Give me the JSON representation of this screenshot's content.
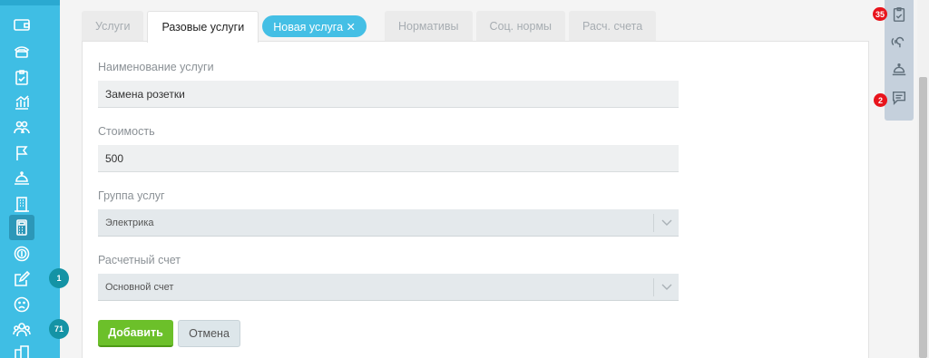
{
  "sidebar": {
    "items": [
      {
        "icon": "wallet-icon"
      },
      {
        "icon": "handset-icon"
      },
      {
        "icon": "clipboard-check-icon"
      },
      {
        "icon": "chart-icon"
      },
      {
        "icon": "people-icon"
      },
      {
        "icon": "flag-icon"
      },
      {
        "icon": "service-bell-icon"
      },
      {
        "icon": "building-icon"
      },
      {
        "icon": "calculator-icon",
        "active": true
      },
      {
        "icon": "coin-icon"
      },
      {
        "icon": "edit-icon",
        "badge": "1"
      },
      {
        "icon": "sad-face-icon"
      },
      {
        "icon": "group-icon",
        "badge": "71"
      },
      {
        "icon": "city-icon"
      }
    ]
  },
  "tabs": [
    {
      "label": "Услуги"
    },
    {
      "label": "Разовые услуги",
      "active": true
    },
    {
      "label": "Новая услуга ✕",
      "pill": true
    },
    {
      "label": "Нормативы"
    },
    {
      "label": "Соц. нормы"
    },
    {
      "label": "Расч. счета"
    }
  ],
  "form": {
    "name_label": "Наименование услуги",
    "name_value": "Замена розетки",
    "cost_label": "Стоимость",
    "cost_value": "500",
    "group_label": "Группа услуг",
    "group_value": "Электрика",
    "account_label": "Расчетный счет",
    "account_value": "Основной счет",
    "add_label": "Добавить",
    "cancel_label": "Отмена"
  },
  "right_tools": {
    "tasks_badge": "35",
    "chat_badge": "2"
  },
  "colors": {
    "sidebar": "#3fbee4",
    "accent": "#44bfe5",
    "add_button": "#6cc02a",
    "badge_red": "#e8141c"
  }
}
